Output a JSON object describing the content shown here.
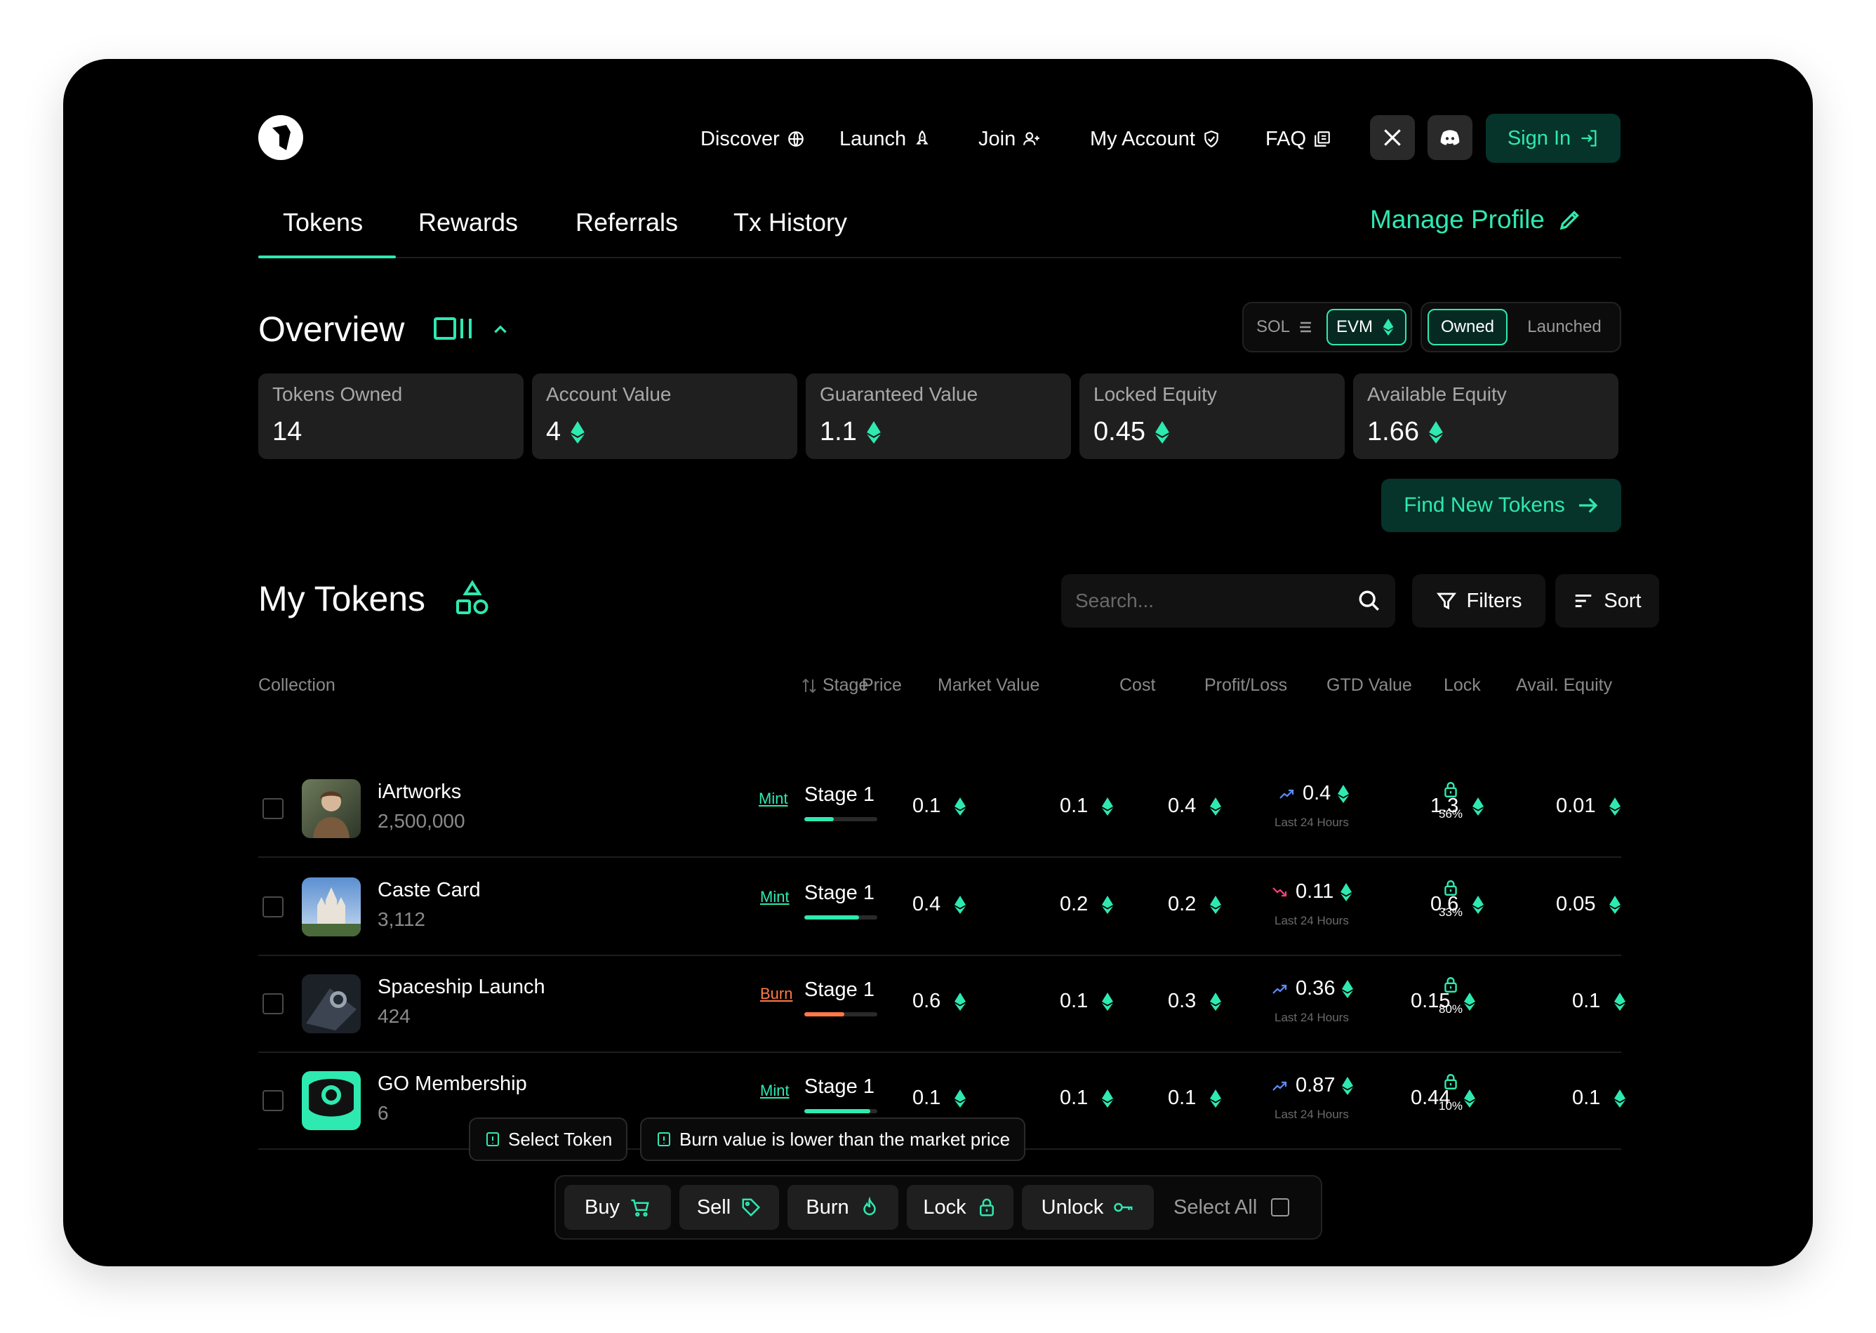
{
  "colors": {
    "accent": "#2ee9b0",
    "accent_bg": "#06332a",
    "down": "#ff3d7f",
    "burn": "#ff7a45",
    "card": "#1f1f1f"
  },
  "nav": {
    "logo": "app-logo",
    "links": [
      {
        "label": "Discover",
        "icon": "globe-icon"
      },
      {
        "label": "Launch",
        "icon": "rocket-icon"
      },
      {
        "label": "Join",
        "icon": "user-plus-icon"
      },
      {
        "label": "My Account",
        "icon": "shield-check-icon"
      },
      {
        "label": "FAQ",
        "icon": "copy-icon"
      }
    ],
    "socials": [
      "x-icon",
      "discord-icon"
    ],
    "sign_in": "Sign In"
  },
  "tabs": [
    "Tokens",
    "Rewards",
    "Referrals",
    "Tx History"
  ],
  "active_tab": "Tokens",
  "manage_profile": "Manage Profile",
  "overview": {
    "title": "Overview",
    "chain_toggle": {
      "options": [
        "SOL",
        "EVM"
      ],
      "active": "EVM"
    },
    "owner_toggle": {
      "options": [
        "Owned",
        "Launched"
      ],
      "active": "Owned"
    },
    "stats": [
      {
        "label": "Tokens Owned",
        "value": "14",
        "eth": false
      },
      {
        "label": "Account Value",
        "value": "4",
        "eth": true
      },
      {
        "label": "Guaranteed Value",
        "value": "1.1",
        "eth": true
      },
      {
        "label": "Locked Equity",
        "value": "0.45",
        "eth": true
      },
      {
        "label": "Available Equity",
        "value": "1.66",
        "eth": true
      }
    ],
    "find_button": "Find New Tokens"
  },
  "my_tokens": {
    "title": "My Tokens",
    "search_placeholder": "Search...",
    "filters": "Filters",
    "sort": "Sort",
    "columns": [
      "Collection",
      "Stage",
      "Price",
      "Market Value",
      "Cost",
      "Profit/Loss",
      "GTD Value",
      "Lock",
      "Avail. Equity"
    ],
    "rows": [
      {
        "name": "iArtworks",
        "supply": "2,500,000",
        "tag": "Mint",
        "stage": "Stage 1",
        "stage_progress": 0.4,
        "price": "0.1",
        "market_value": "0.1",
        "cost": "0.4",
        "pl": "0.4",
        "pl_trend": "up",
        "pl_sub": "Last 24 Hours",
        "gtd": "1.3",
        "lock": "56%",
        "avail": "0.01"
      },
      {
        "name": "Caste Card",
        "supply": "3,112",
        "tag": "Mint",
        "stage": "Stage 1",
        "stage_progress": 0.75,
        "price": "0.4",
        "market_value": "0.2",
        "cost": "0.2",
        "pl": "0.11",
        "pl_trend": "down",
        "pl_sub": "Last 24 Hours",
        "gtd": "0.6",
        "lock": "33%",
        "avail": "0.05"
      },
      {
        "name": "Spaceship Launch",
        "supply": "424",
        "tag": "Burn",
        "stage": "Stage 1",
        "stage_progress": 0.55,
        "price": "0.6",
        "market_value": "0.1",
        "cost": "0.3",
        "pl": "0.36",
        "pl_trend": "up",
        "pl_sub": "Last 24 Hours",
        "gtd": "0.15",
        "lock": "80%",
        "avail": "0.1"
      },
      {
        "name": "GO Membership",
        "supply": "6",
        "tag": "Mint",
        "stage": "Stage 1",
        "stage_progress": 0.9,
        "price": "0.1",
        "market_value": "0.1",
        "cost": "0.1",
        "pl": "0.87",
        "pl_trend": "up",
        "pl_sub": "Last 24 Hours",
        "gtd": "0.44",
        "lock": "10%",
        "avail": "0.1"
      }
    ]
  },
  "hints": [
    "Select Token",
    "Burn value is lower than the market price"
  ],
  "actions": [
    {
      "label": "Buy",
      "icon": "cart-icon"
    },
    {
      "label": "Sell",
      "icon": "tag-icon"
    },
    {
      "label": "Burn",
      "icon": "flame-icon"
    },
    {
      "label": "Lock",
      "icon": "lock-icon"
    },
    {
      "label": "Unlock",
      "icon": "key-icon"
    }
  ],
  "select_all": "Select All"
}
